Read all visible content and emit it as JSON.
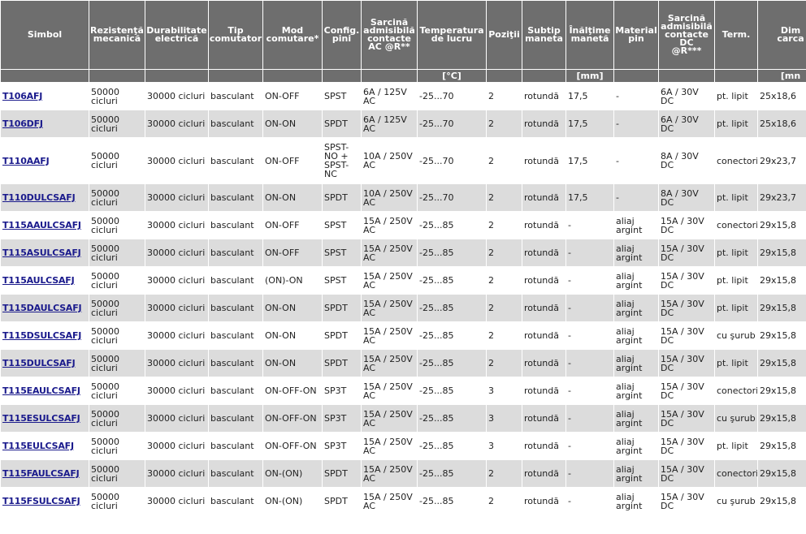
{
  "headers": [
    "Simbol",
    "Rezistenţă\nmecanică",
    "Durabilitate\nelectrică",
    "Tip\ncomutator",
    "Mod\ncomutare*",
    "Config.\npini",
    "Sarcină\nadmisibilă\ncontacte\nAC @R**",
    "Temperatura\nde lucru",
    "Poziţii",
    "Subtip\nmaneta",
    "Înălţime\nmanetă",
    "Material\npin",
    "Sarcină\nadmisibilă\ncontacte\nDC\n@R***",
    "Term.",
    "Dim\ncarca"
  ],
  "units": [
    "",
    "",
    "",
    "",
    "",
    "",
    "",
    "[°C]",
    "",
    "",
    "[mm]",
    "",
    "",
    "",
    "[mn"
  ],
  "rows": [
    {
      "cells": [
        "T106AFJ",
        "50000 cicluri",
        "30000 cicluri",
        "basculant",
        "ON-OFF",
        "SPST",
        "6A / 125V AC",
        "-25...70",
        "2",
        "rotundă",
        "17,5",
        "-",
        "6A / 30V DC",
        "pt. lipit",
        "25x18,6"
      ]
    },
    {
      "cells": [
        "T106DFJ",
        "50000 cicluri",
        "30000 cicluri",
        "basculant",
        "ON-ON",
        "SPDT",
        "6A / 125V AC",
        "-25...70",
        "2",
        "rotundă",
        "17,5",
        "-",
        "6A / 30V DC",
        "pt. lipit",
        "25x18,6"
      ]
    },
    {
      "cells": [
        "T110AAFJ",
        "50000 cicluri",
        "30000 cicluri",
        "basculant",
        "ON-OFF",
        "SPST-NO + SPST-NC",
        "10A / 250V AC",
        "-25...70",
        "2",
        "rotundă",
        "17,5",
        "-",
        "8A / 30V DC",
        "conectori",
        "29x23,7"
      ]
    },
    {
      "cells": [
        "T110DULCSAFJ",
        "50000 cicluri",
        "30000 cicluri",
        "basculant",
        "ON-ON",
        "SPDT",
        "10A / 250V AC",
        "-25...70",
        "2",
        "rotundă",
        "17,5",
        "-",
        "8A / 30V DC",
        "pt. lipit",
        "29x23,7"
      ]
    },
    {
      "cells": [
        "T115AAULCSAFJ",
        "50000 cicluri",
        "30000 cicluri",
        "basculant",
        "ON-OFF",
        "SPST",
        "15A / 250V AC",
        "-25...85",
        "2",
        "rotundă",
        "-",
        "aliaj argint",
        "15A / 30V DC",
        "conectori",
        "29x15,8"
      ]
    },
    {
      "cells": [
        "T115ASULCSAFJ",
        "50000 cicluri",
        "30000 cicluri",
        "basculant",
        "ON-OFF",
        "SPST",
        "15A / 250V AC",
        "-25...85",
        "2",
        "rotundă",
        "-",
        "aliaj argint",
        "15A / 30V DC",
        "pt. lipit",
        "29x15,8"
      ]
    },
    {
      "cells": [
        "T115AULCSAFJ",
        "50000 cicluri",
        "30000 cicluri",
        "basculant",
        "(ON)-ON",
        "SPST",
        "15A / 250V AC",
        "-25...85",
        "2",
        "rotundă",
        "-",
        "aliaj argint",
        "15A / 30V DC",
        "pt. lipit",
        "29x15,8"
      ]
    },
    {
      "cells": [
        "T115DAULCSAFJ",
        "50000 cicluri",
        "30000 cicluri",
        "basculant",
        "ON-ON",
        "SPDT",
        "15A / 250V AC",
        "-25...85",
        "2",
        "rotundă",
        "-",
        "aliaj argint",
        "15A / 30V DC",
        "pt. lipit",
        "29x15,8"
      ]
    },
    {
      "cells": [
        "T115DSULCSAFJ",
        "50000 cicluri",
        "30000 cicluri",
        "basculant",
        "ON-ON",
        "SPDT",
        "15A / 250V AC",
        "-25...85",
        "2",
        "rotundă",
        "-",
        "aliaj argint",
        "15A / 30V DC",
        "cu şurub",
        "29x15,8"
      ]
    },
    {
      "cells": [
        "T115DULCSAFJ",
        "50000 cicluri",
        "30000 cicluri",
        "basculant",
        "ON-ON",
        "SPDT",
        "15A / 250V AC",
        "-25...85",
        "2",
        "rotundă",
        "-",
        "aliaj argint",
        "15A / 30V DC",
        "pt. lipit",
        "29x15,8"
      ]
    },
    {
      "cells": [
        "T115EAULCSAFJ",
        "50000 cicluri",
        "30000 cicluri",
        "basculant",
        "ON-OFF-ON",
        "SP3T",
        "15A / 250V AC",
        "-25...85",
        "3",
        "rotundă",
        "-",
        "aliaj argint",
        "15A / 30V DC",
        "conectori",
        "29x15,8"
      ]
    },
    {
      "cells": [
        "T115ESULCSAFJ",
        "50000 cicluri",
        "30000 cicluri",
        "basculant",
        "ON-OFF-ON",
        "SP3T",
        "15A / 250V AC",
        "-25...85",
        "3",
        "rotundă",
        "-",
        "aliaj argint",
        "15A / 30V DC",
        "cu şurub",
        "29x15,8"
      ]
    },
    {
      "cells": [
        "T115EULCSAFJ",
        "50000 cicluri",
        "30000 cicluri",
        "basculant",
        "ON-OFF-ON",
        "SP3T",
        "15A / 250V AC",
        "-25...85",
        "3",
        "rotundă",
        "-",
        "aliaj argint",
        "15A / 30V DC",
        "pt. lipit",
        "29x15,8"
      ]
    },
    {
      "cells": [
        "T115FAULCSAFJ",
        "50000 cicluri",
        "30000 cicluri",
        "basculant",
        "ON-(ON)",
        "SPDT",
        "15A / 250V AC",
        "-25...85",
        "2",
        "rotundă",
        "-",
        "aliaj argint",
        "15A / 30V DC",
        "conectori",
        "29x15,8"
      ]
    },
    {
      "cells": [
        "T115FSULCSAFJ",
        "50000 cicluri",
        "30000 cicluri",
        "basculant",
        "ON-(ON)",
        "SPDT",
        "15A / 250V AC",
        "-25...85",
        "2",
        "rotundă",
        "-",
        "aliaj argint",
        "15A / 30V DC",
        "cu şurub",
        "29x15,8"
      ]
    }
  ]
}
